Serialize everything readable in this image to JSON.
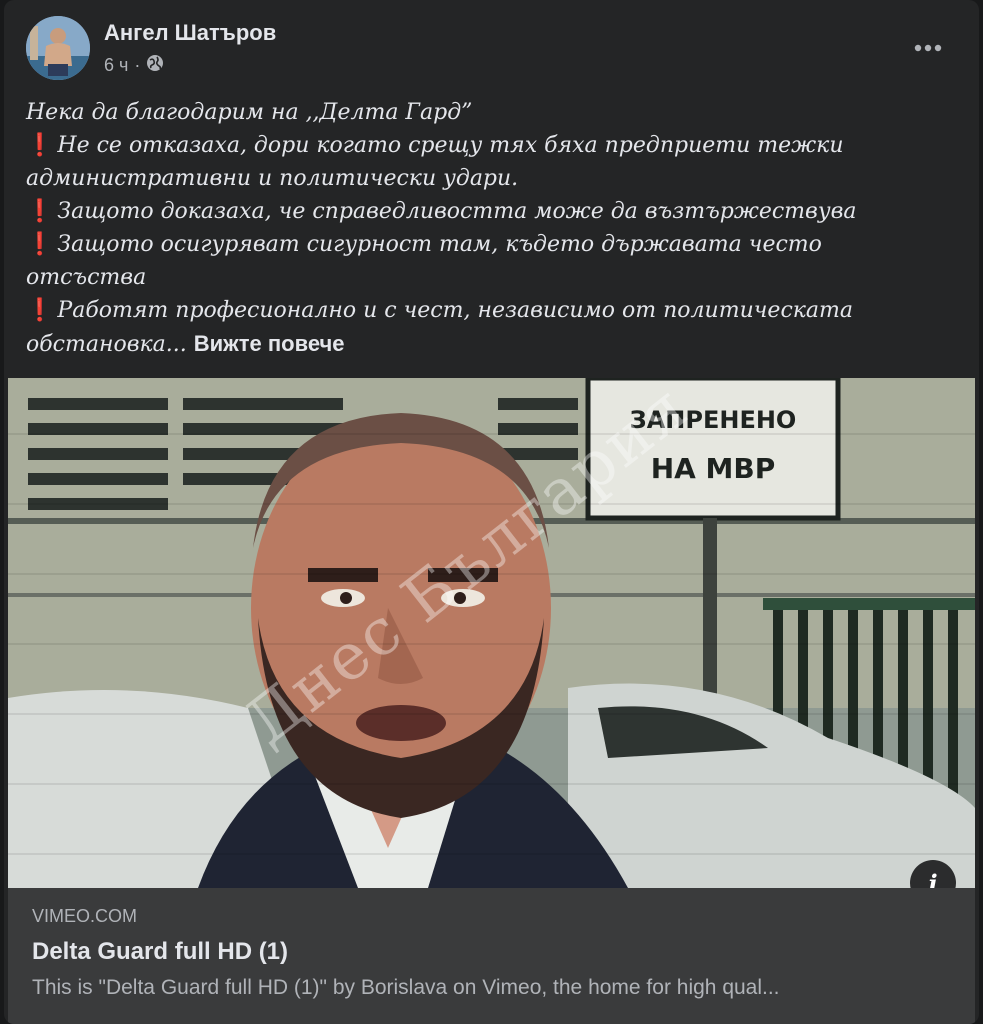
{
  "post": {
    "author": "Ангел Шатъров",
    "time": "6 ч",
    "separator": "·",
    "privacy_icon": "globe-icon",
    "menu_icon": "more-dots-icon",
    "lines": [
      "Нека да благодарим на ,,Делта Гард”",
      "Не се отказаха, дори когато срещу тях бяха предприети тежки",
      "административни и политически удари.",
      "Защото доказаха, че справедливостта може да възтържествува",
      "Защото осигуряват сигурност там, където държавата често",
      "отсъства",
      "Работят професионално и с чест, независимо от политическата",
      "обстановка..."
    ],
    "bullet": "❗",
    "see_more": "Вижте повече"
  },
  "media": {
    "sign_text_1": "ЗАПРЕНЕНО",
    "sign_text_2": "НА МВР",
    "watermark": "Днес България"
  },
  "link_preview": {
    "domain": "VIMEO.COM",
    "title": "Delta Guard full HD (1)",
    "description": "This is \"Delta Guard full HD (1)\" by Borislava on Vimeo, the home for high qual...",
    "info_icon": "i"
  },
  "colors": {
    "card_bg": "#242526",
    "link_bg": "#3a3b3c",
    "text": "#e4e6eb",
    "secondary": "#b0b3b8",
    "bullet": "#e63946"
  }
}
